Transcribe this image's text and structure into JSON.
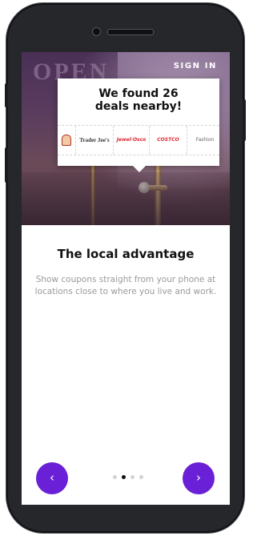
{
  "header": {
    "sign_in_label": "SIGN IN"
  },
  "hero": {
    "storefront_sign_text": "OPEN"
  },
  "deal_card": {
    "title": "We found 26\ndeals nearby!",
    "brands": [
      {
        "name": "Dunkin Donuts-like mascot",
        "label": ""
      },
      {
        "name": "Trader Joe's",
        "label": "Trader Joe's"
      },
      {
        "name": "Jewel-Osco",
        "label": "Jewel·Osco"
      },
      {
        "name": "Costco",
        "label": "COSTCO"
      },
      {
        "name": "Fashion",
        "label": "Fashion"
      }
    ]
  },
  "main": {
    "headline": "The local advantage",
    "description": "Show coupons straight from your phone at locations close to where you live and work."
  },
  "pager": {
    "prev_label": "‹",
    "next_label": "›",
    "pages": 4,
    "current_page": 2
  },
  "colors": {
    "accent": "#6a20d6",
    "phone_body": "#26272b",
    "description_text": "#9a9a9a"
  }
}
